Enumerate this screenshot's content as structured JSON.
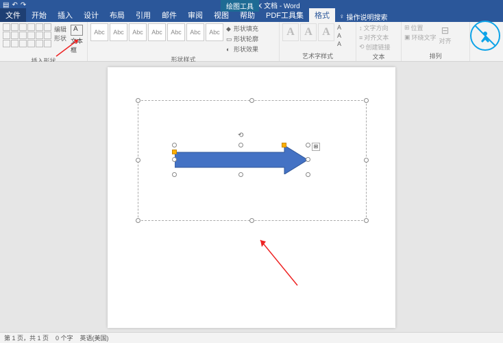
{
  "app": {
    "title": "新建 DOCX 文档 - Word",
    "context_tab": "绘图工具"
  },
  "tabs": {
    "file": "文件",
    "home": "开始",
    "insert": "插入",
    "design": "设计",
    "layout": "布局",
    "references": "引用",
    "mail": "邮件",
    "review": "审阅",
    "view": "视图",
    "help": "帮助",
    "pdf": "PDF工具集",
    "format": "格式",
    "tellme": "操作说明搜索"
  },
  "ribbon": {
    "insert_shapes": {
      "label": "插入形状",
      "edit_shape": "编辑形状",
      "textbox": "文本框"
    },
    "shape_styles": {
      "label": "形状样式",
      "sample": "Abc",
      "fill": "形状填充",
      "outline": "形状轮廓",
      "effects": "形状效果"
    },
    "wordart_styles": {
      "label": "艺术字样式",
      "sample": "A"
    },
    "text": {
      "label": "文本",
      "direction": "文字方向",
      "align": "对齐文本",
      "link": "创建链接"
    },
    "arrange": {
      "label": "排列",
      "position": "位置",
      "wrap": "环绕文字",
      "align_btn": "对齐"
    }
  },
  "statusbar": {
    "page": "第 1 页，共 1 页",
    "words": "0 个字",
    "lang": "英语(美国)"
  }
}
